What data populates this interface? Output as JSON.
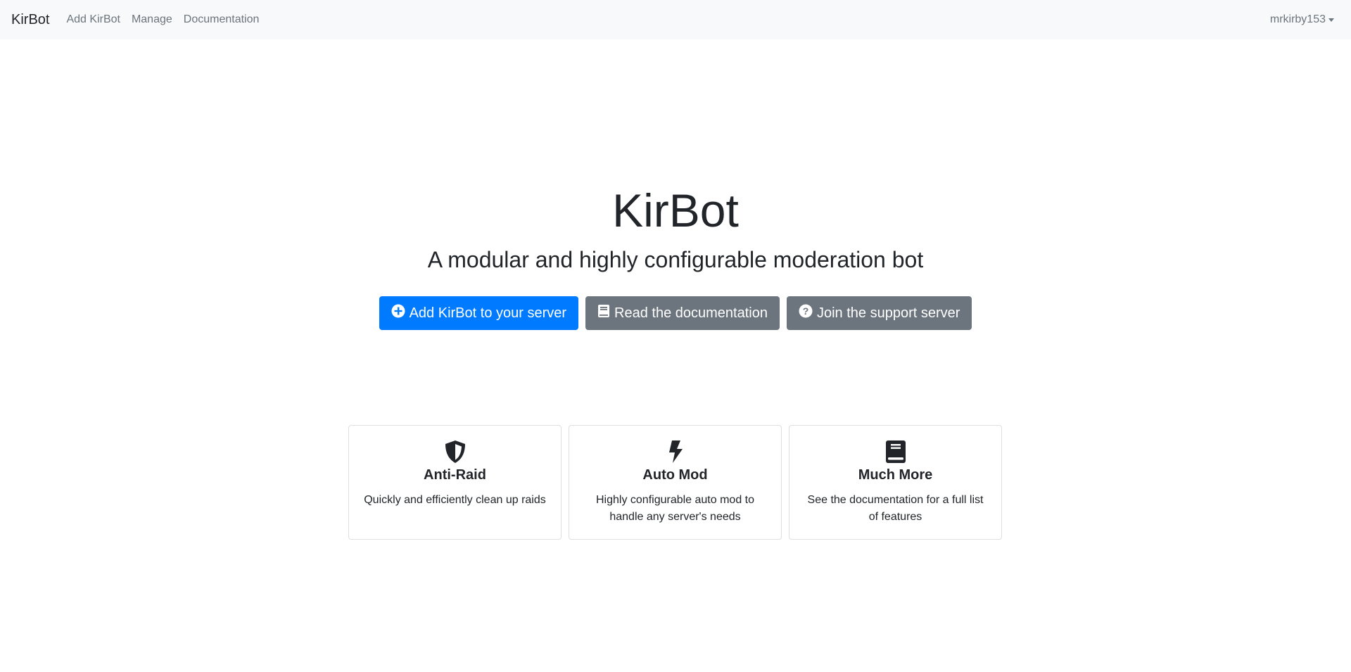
{
  "navbar": {
    "brand": "KirBot",
    "links": [
      "Add KirBot",
      "Manage",
      "Documentation"
    ],
    "user": "mrkirby153"
  },
  "hero": {
    "title": "KirBot",
    "subtitle": "A modular and highly configurable moderation bot",
    "buttons": [
      {
        "label": "Add KirBot to your server",
        "icon": "plus-circle-icon",
        "color": "#007bff"
      },
      {
        "label": "Read the documentation",
        "icon": "book-icon",
        "color": "#6c757d"
      },
      {
        "label": "Join the support server",
        "icon": "question-circle-icon",
        "color": "#6c757d"
      }
    ]
  },
  "features": [
    {
      "title": "Anti-Raid",
      "text": "Quickly and efficiently clean up raids",
      "icon": "shield-icon"
    },
    {
      "title": "Auto Mod",
      "text": "Highly configurable auto mod to handle any server's needs",
      "icon": "bolt-icon"
    },
    {
      "title": "Much More",
      "text": "See the documentation for a full list of features",
      "icon": "book-icon"
    }
  ]
}
